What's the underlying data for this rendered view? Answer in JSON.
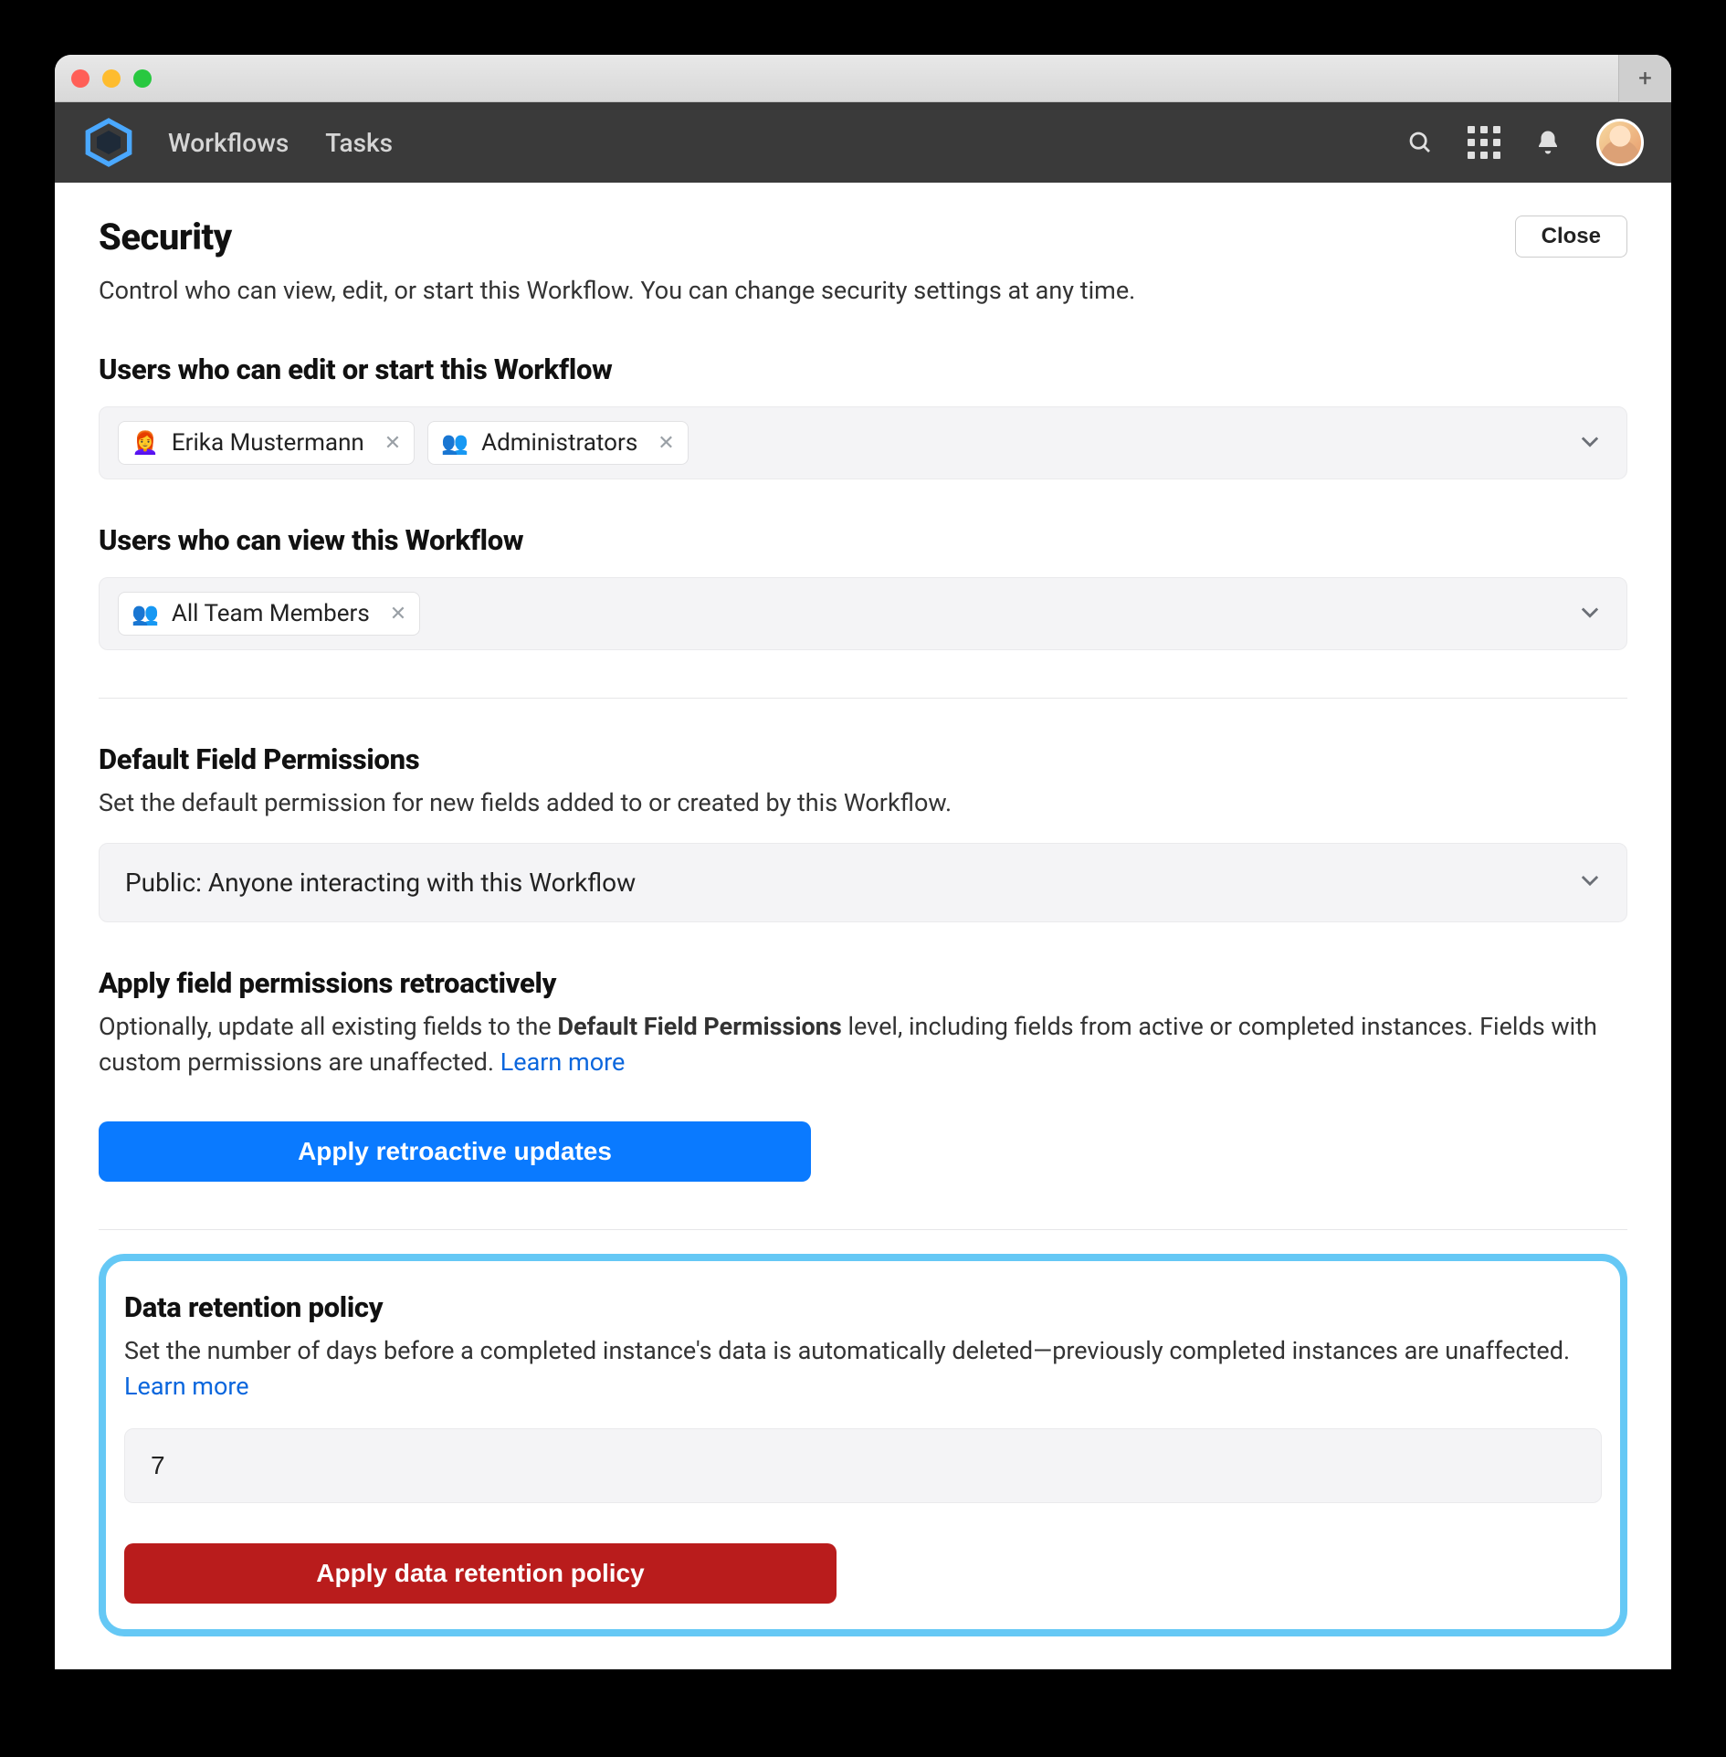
{
  "window": {
    "plus": "+"
  },
  "nav": {
    "workflows": "Workflows",
    "tasks": "Tasks"
  },
  "header": {
    "title": "Security",
    "subtitle": "Control who can view, edit, or start this Workflow. You can change security settings at any time.",
    "close": "Close"
  },
  "editors": {
    "heading": "Users who can edit or start this Workflow",
    "chips": [
      {
        "icon": "👩‍🦰",
        "label": "Erika Mustermann"
      },
      {
        "icon": "👥",
        "label": "Administrators"
      }
    ]
  },
  "viewers": {
    "heading": "Users who can view this Workflow",
    "chips": [
      {
        "icon": "👥",
        "label": "All Team Members"
      }
    ]
  },
  "defaultPerms": {
    "heading": "Default Field Permissions",
    "desc": "Set the default permission for new fields added to or created by this Workflow.",
    "selected": "Public: Anyone interacting with this Workflow"
  },
  "retroactive": {
    "heading": "Apply field permissions retroactively",
    "desc_pre": "Optionally, update all existing fields to the ",
    "desc_bold": "Default Field Permissions",
    "desc_post": " level, including fields from active or completed instances. Fields with custom permissions are unaffected. ",
    "learn_more": "Learn more",
    "button": "Apply retroactive updates"
  },
  "retention": {
    "heading": "Data retention policy",
    "desc": "Set the number of days before a completed instance's data is automatically deleted—previously completed instances are unaffected. ",
    "learn_more": "Learn more",
    "value": "7",
    "button": "Apply data retention policy"
  }
}
